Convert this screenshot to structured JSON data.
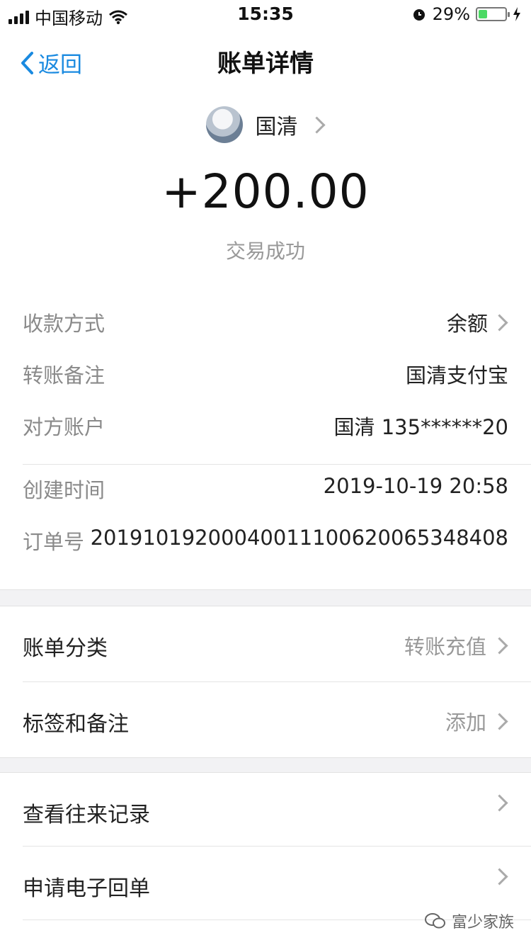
{
  "statusbar": {
    "carrier": "中国移动",
    "time": "15:35",
    "battery": "29%",
    "battery_level": 0.29
  },
  "nav": {
    "back_label": "返回",
    "title": "账单详情"
  },
  "header": {
    "payer_name": "国清",
    "amount": "+200.00",
    "status": "交易成功"
  },
  "details": {
    "payment_method_label": "收款方式",
    "payment_method_value": "余额",
    "memo_label": "转账备注",
    "memo_value": "国清支付宝",
    "account_label": "对方账户",
    "account_value": "国清 135******20",
    "created_label": "创建时间",
    "created_value": "2019-10-19 20:58",
    "order_label": "订单号",
    "order_value": "20191019200040011100620065348408"
  },
  "classify": {
    "category_label": "账单分类",
    "category_value": "转账充值",
    "tag_label": "标签和备注",
    "tag_value": "添加"
  },
  "actions": {
    "history_label": "查看往来记录",
    "receipt_label": "申请电子回单"
  },
  "watermark": {
    "text": "富少家族"
  },
  "colors": {
    "accent": "#1a8ae0",
    "battery": "#4cd964"
  }
}
